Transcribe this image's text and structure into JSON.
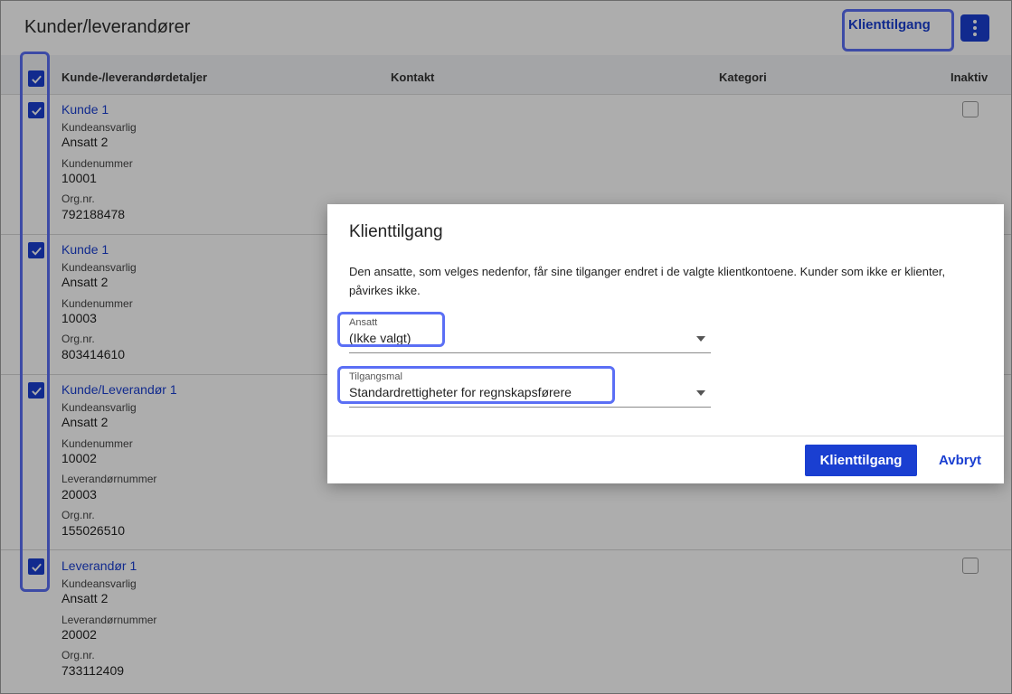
{
  "page": {
    "title": "Kunder/leverandører",
    "client_access_button": "Klienttilgang",
    "more_icon": "kebab-vertical-icon"
  },
  "table": {
    "headers": {
      "details": "Kunde-/leverandørdetaljer",
      "contact": "Kontakt",
      "category": "Kategori",
      "inactive": "Inaktiv"
    },
    "rows": [
      {
        "name": "Kunde 1",
        "checked": true,
        "fields": [
          {
            "label": "Kundeansvarlig",
            "value": "Ansatt 2"
          },
          {
            "label": "Kundenummer",
            "value": "10001"
          },
          {
            "label": "Org.nr.",
            "value": "792188478"
          }
        ]
      },
      {
        "name": "Kunde 1",
        "checked": true,
        "fields": [
          {
            "label": "Kundeansvarlig",
            "value": "Ansatt 2"
          },
          {
            "label": "Kundenummer",
            "value": "10003"
          },
          {
            "label": "Org.nr.",
            "value": "803414610"
          }
        ]
      },
      {
        "name": "Kunde/Leverandør 1",
        "checked": true,
        "fields": [
          {
            "label": "Kundeansvarlig",
            "value": "Ansatt 2"
          },
          {
            "label": "Kundenummer",
            "value": "10002"
          },
          {
            "label": "Leverandørnummer",
            "value": "20003"
          },
          {
            "label": "Org.nr.",
            "value": "155026510"
          }
        ]
      },
      {
        "name": "Leverandør 1",
        "checked": true,
        "fields": [
          {
            "label": "Kundeansvarlig",
            "value": "Ansatt 2"
          },
          {
            "label": "Leverandørnummer",
            "value": "20002"
          },
          {
            "label": "Org.nr.",
            "value": "733112409"
          }
        ]
      }
    ]
  },
  "dialog": {
    "title": "Klienttilgang",
    "description": "Den ansatte, som velges nedenfor, får sine tilganger endret i de valgte klientkontoene. Kunder som ikke er klienter, påvirkes ikke.",
    "employee_field": {
      "label": "Ansatt",
      "value": "(Ikke valgt)"
    },
    "template_field": {
      "label": "Tilgangsmal",
      "value": "Standardrettigheter for regnskapsførere"
    },
    "confirm_button": "Klienttilgang",
    "cancel_button": "Avbryt"
  },
  "colors": {
    "accent": "#1a3fd1",
    "highlight": "#5b6ff5"
  }
}
